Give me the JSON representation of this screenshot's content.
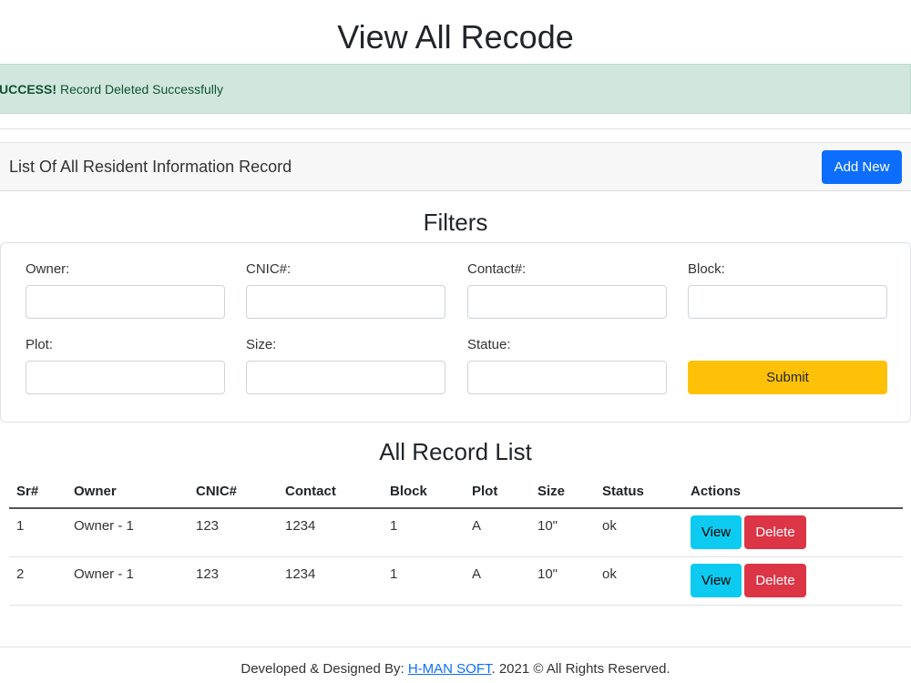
{
  "page": {
    "title": "View All Recode"
  },
  "alert": {
    "strong": "UCCESS!",
    "message": "Record Deleted Successfully"
  },
  "header": {
    "title": "List Of All Resident Information Record",
    "add_button": "Add New"
  },
  "filters": {
    "title": "Filters",
    "owner_label": "Owner:",
    "cnic_label": "CNIC#:",
    "contact_label": "Contact#:",
    "block_label": "Block:",
    "plot_label": "Plot:",
    "size_label": "Size:",
    "statue_label": "Statue:",
    "submit_label": "Submit"
  },
  "list": {
    "title": "All Record List",
    "columns": [
      "Sr#",
      "Owner",
      "CNIC#",
      "Contact",
      "Block",
      "Plot",
      "Size",
      "Status",
      "Actions"
    ],
    "rows": [
      {
        "sr": "1",
        "owner": "Owner - 1",
        "cnic": "123",
        "contact": "1234",
        "block": "1",
        "plot": "A",
        "size": "10\"",
        "status": "ok",
        "view": "View",
        "delete": "Delete"
      },
      {
        "sr": "2",
        "owner": "Owner - 1",
        "cnic": "123",
        "contact": "1234",
        "block": "1",
        "plot": "A",
        "size": "10\"",
        "status": "ok",
        "view": "View",
        "delete": "Delete"
      }
    ]
  },
  "footer": {
    "prefix": "Developed & Designed By: ",
    "link_text": "H-MAN SOFT",
    "suffix": ". 2021 © All Rights Reserved."
  },
  "colors": {
    "primary": "#0d6efd",
    "warning": "#ffc107",
    "info": "#0dcaf0",
    "danger": "#dc3545",
    "alert_bg": "#d1e7dd"
  }
}
